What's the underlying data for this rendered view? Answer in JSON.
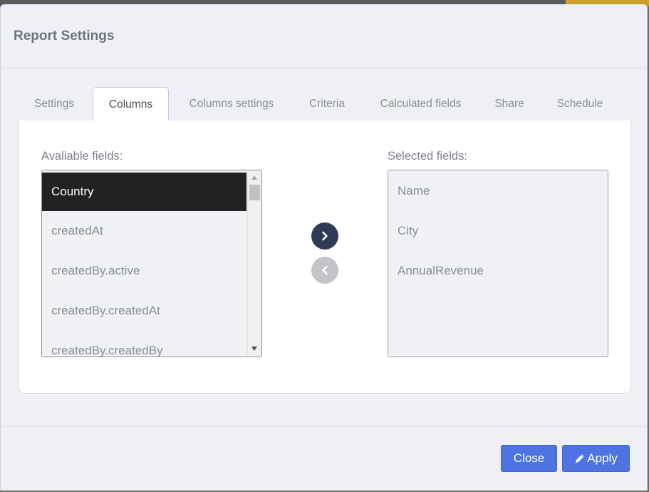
{
  "dialog": {
    "title": "Report Settings"
  },
  "tabs": [
    {
      "label": "Settings",
      "active": false
    },
    {
      "label": "Columns",
      "active": true
    },
    {
      "label": "Columns settings",
      "active": false
    },
    {
      "label": "Criteria",
      "active": false
    },
    {
      "label": "Calculated fields",
      "active": false
    },
    {
      "label": "Share",
      "active": false
    },
    {
      "label": "Schedule",
      "active": false
    }
  ],
  "available": {
    "label": "Avaliable fields:",
    "items": [
      "Country",
      "createdAt",
      "createdBy.active",
      "createdBy.createdAt",
      "createdBy.createdBy"
    ],
    "selected_item": "Country"
  },
  "selected": {
    "label": "Selected fields:",
    "items": [
      "Name",
      "City",
      "AnnualRevenue"
    ]
  },
  "icons": {
    "add": "chevron-right-icon",
    "remove": "chevron-left-icon",
    "apply": "pencil-icon"
  },
  "buttons": {
    "close": "Close",
    "apply": "Apply"
  },
  "colors": {
    "primary": "#4d74e0",
    "add_button": "#2f3a56",
    "remove_button": "#c2c4c8",
    "selected_row": "#222222"
  }
}
